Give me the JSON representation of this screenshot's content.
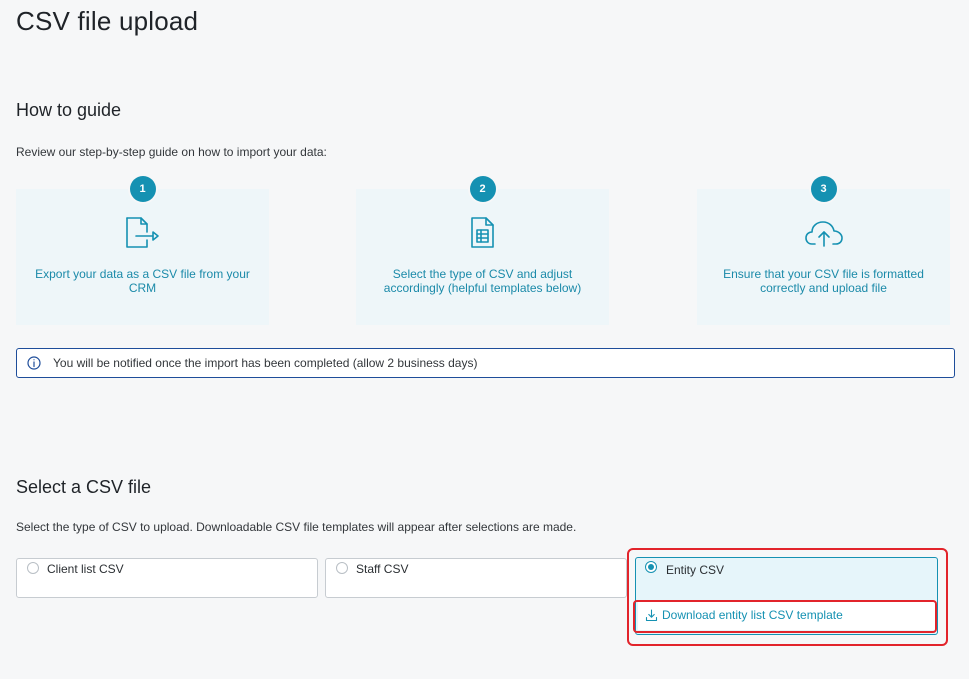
{
  "page": {
    "title": "CSV file upload"
  },
  "guide": {
    "title": "How to guide",
    "description": "Review our step-by-step guide on how to import your data:",
    "steps": [
      {
        "number": "1",
        "icon": "export-file-icon",
        "text": "Export your data as a CSV file from your CRM"
      },
      {
        "number": "2",
        "icon": "spreadsheet-file-icon",
        "text": "Select the type of CSV and adjust accordingly (helpful templates below)"
      },
      {
        "number": "3",
        "icon": "cloud-upload-icon",
        "text": "Ensure that your CSV file is formatted correctly and upload file"
      }
    ],
    "notice": "You will be notified once the import has been completed (allow 2 business days)"
  },
  "select": {
    "title": "Select a CSV file",
    "description": "Select the type of CSV to upload. Downloadable CSV file templates will appear after selections are made.",
    "options": [
      {
        "label": "Client list CSV",
        "selected": false
      },
      {
        "label": "Staff CSV",
        "selected": false
      },
      {
        "label": "Entity CSV",
        "selected": true
      }
    ],
    "download_label": "Download entity list CSV template"
  },
  "colors": {
    "accent": "#1591b2",
    "highlight": "#e2242b",
    "notice_border": "#1e4d9a",
    "card_bg": "#eef6f9"
  }
}
